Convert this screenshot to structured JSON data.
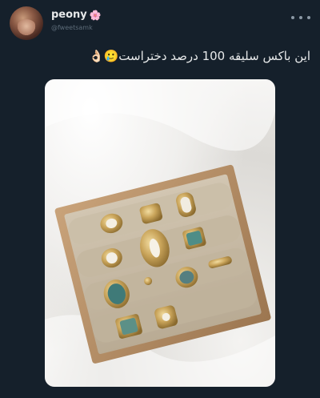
{
  "author": {
    "display_name": "peony",
    "name_emoji": "🌸",
    "handle": "@fweetsamk"
  },
  "tweet": {
    "text": "این باکس سلیقه 100 درصد دختراست🥲👌🏻"
  },
  "icons": {
    "more": "more-horizontal-icon"
  },
  "colors": {
    "background": "#15202b",
    "text": "#e7e9ea",
    "muted": "#8b98a5"
  }
}
